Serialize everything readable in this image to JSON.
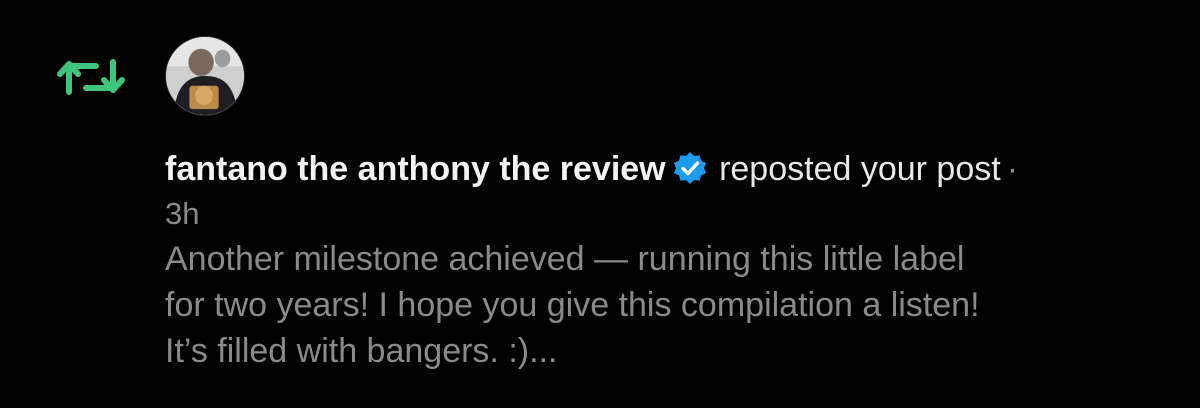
{
  "icons": {
    "repost": "repost-icon",
    "verified": "verified-badge-icon",
    "avatar": "avatar"
  },
  "colors": {
    "background": "#000000",
    "repost_accent": "#3fc47c",
    "verified_badge": "#1d9bf0",
    "username": "#f3f3f3",
    "secondary_text": "#8a8a8a"
  },
  "notification": {
    "username": "fantano the anthony the review",
    "action": "reposted your post",
    "separator": "·",
    "timestamp": "3h",
    "post_lines": [
      "Another milestone achieved — running this little label",
      "for two years! I hope you give this compilation a listen!",
      "It’s filled with bangers. :)..."
    ]
  }
}
